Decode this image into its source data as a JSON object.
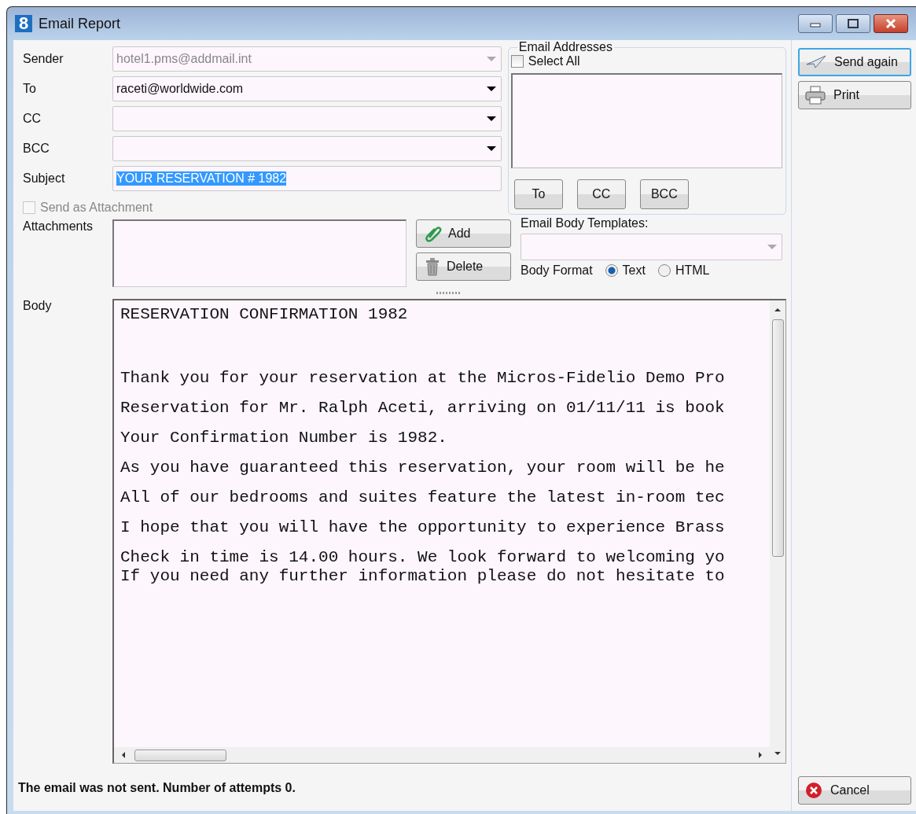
{
  "window": {
    "icon_text": "8",
    "title": "Email Report"
  },
  "fields": [
    {
      "label": "Sender",
      "value": "hotel1.pms@addmail.int",
      "kind": "combo",
      "disabled": true
    },
    {
      "label": "To",
      "value": "raceti@worldwide.com",
      "kind": "combo",
      "disabled": false
    },
    {
      "label": "CC",
      "kind": "combo",
      "disabled": false
    },
    {
      "label": "BCC",
      "kind": "combo",
      "disabled": false
    },
    {
      "label": "Subject",
      "value": "YOUR RESERVATION # 1982",
      "kind": "text",
      "disabled": false,
      "text_selected": true
    }
  ],
  "send_as_attachment": {
    "label": "Send as Attachment",
    "checked": false,
    "disabled": true
  },
  "email_addresses": {
    "title": "Email Addresses",
    "select_all": {
      "label": "Select All",
      "checked": false
    },
    "buttons": [
      "To",
      "CC",
      "BCC"
    ]
  },
  "attachments": {
    "label": "Attachments",
    "buttons": [
      {
        "label": "Add",
        "kind": "add"
      },
      {
        "label": "Delete",
        "kind": "delete"
      }
    ]
  },
  "templates": {
    "label": "Email Body Templates:"
  },
  "body_format": {
    "label": "Body Format",
    "options": [
      {
        "label": "Text",
        "selected": true
      },
      {
        "label": "HTML",
        "selected": false
      }
    ]
  },
  "body": {
    "label": "Body",
    "paragraphs": [
      {
        "lines": [
          "RESERVATION CONFIRMATION 1982"
        ]
      },
      {
        "lines": [
          "Thank you for your reservation at the Micros-Fidelio Demo Pro"
        ]
      },
      {
        "lines": [
          "Reservation for Mr. Ralph Aceti, arriving on 01/11/11 is book"
        ]
      },
      {
        "lines": [
          "Your Confirmation Number is 1982."
        ]
      },
      {
        "lines": [
          "As you have guaranteed this reservation, your room will be he"
        ]
      },
      {
        "lines": [
          "All of our bedrooms and suites feature the latest in-room tec"
        ]
      },
      {
        "lines": [
          "I hope that you will have the opportunity to experience Brass"
        ]
      },
      {
        "lines": [
          "Check in time is 14.00 hours. We look forward to welcoming yo",
          "If you need any further information please do not hesitate to"
        ]
      }
    ]
  },
  "actions": [
    {
      "label": "Send again",
      "kind": "send",
      "default": true
    },
    {
      "label": "Print",
      "kind": "print",
      "default": false
    }
  ],
  "cancel": {
    "label": "Cancel"
  },
  "status": "The email was not sent. Number of attempts 0."
}
